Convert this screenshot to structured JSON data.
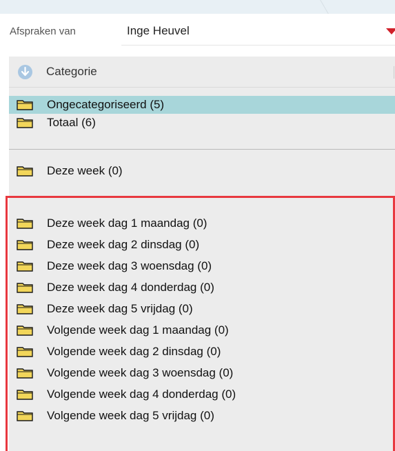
{
  "owner": {
    "label": "Afspraken van",
    "value": "Inge Heuvel"
  },
  "category_header": {
    "label": "Categorie",
    "icon": "sort-down-icon"
  },
  "top_items": [
    {
      "label": "Ongecategoriseerd (5)",
      "selected": true
    },
    {
      "label": "Totaal (6)",
      "selected": false
    }
  ],
  "week_item": {
    "label": "Deze week (0)"
  },
  "day_items": [
    {
      "label": "Deze week dag 1 maandag (0)"
    },
    {
      "label": "Deze week dag 2 dinsdag (0)"
    },
    {
      "label": "Deze week dag 3 woensdag (0)"
    },
    {
      "label": "Deze week dag 4 donderdag (0)"
    },
    {
      "label": "Deze week dag 5 vrijdag (0)"
    },
    {
      "label": "Volgende week dag 1 maandag (0)"
    },
    {
      "label": "Volgende week dag 2 dinsdag (0)"
    },
    {
      "label": "Volgende week dag 3 woensdag (0)"
    },
    {
      "label": "Volgende week dag 4 donderdag (0)"
    },
    {
      "label": "Volgende week dag 5 vrijdag (0)"
    }
  ],
  "colors": {
    "selected_row": "#a8d6da",
    "highlight_border": "#e8383f",
    "dropdown_arrow": "#d0202a",
    "folder": "#f2d65a"
  }
}
